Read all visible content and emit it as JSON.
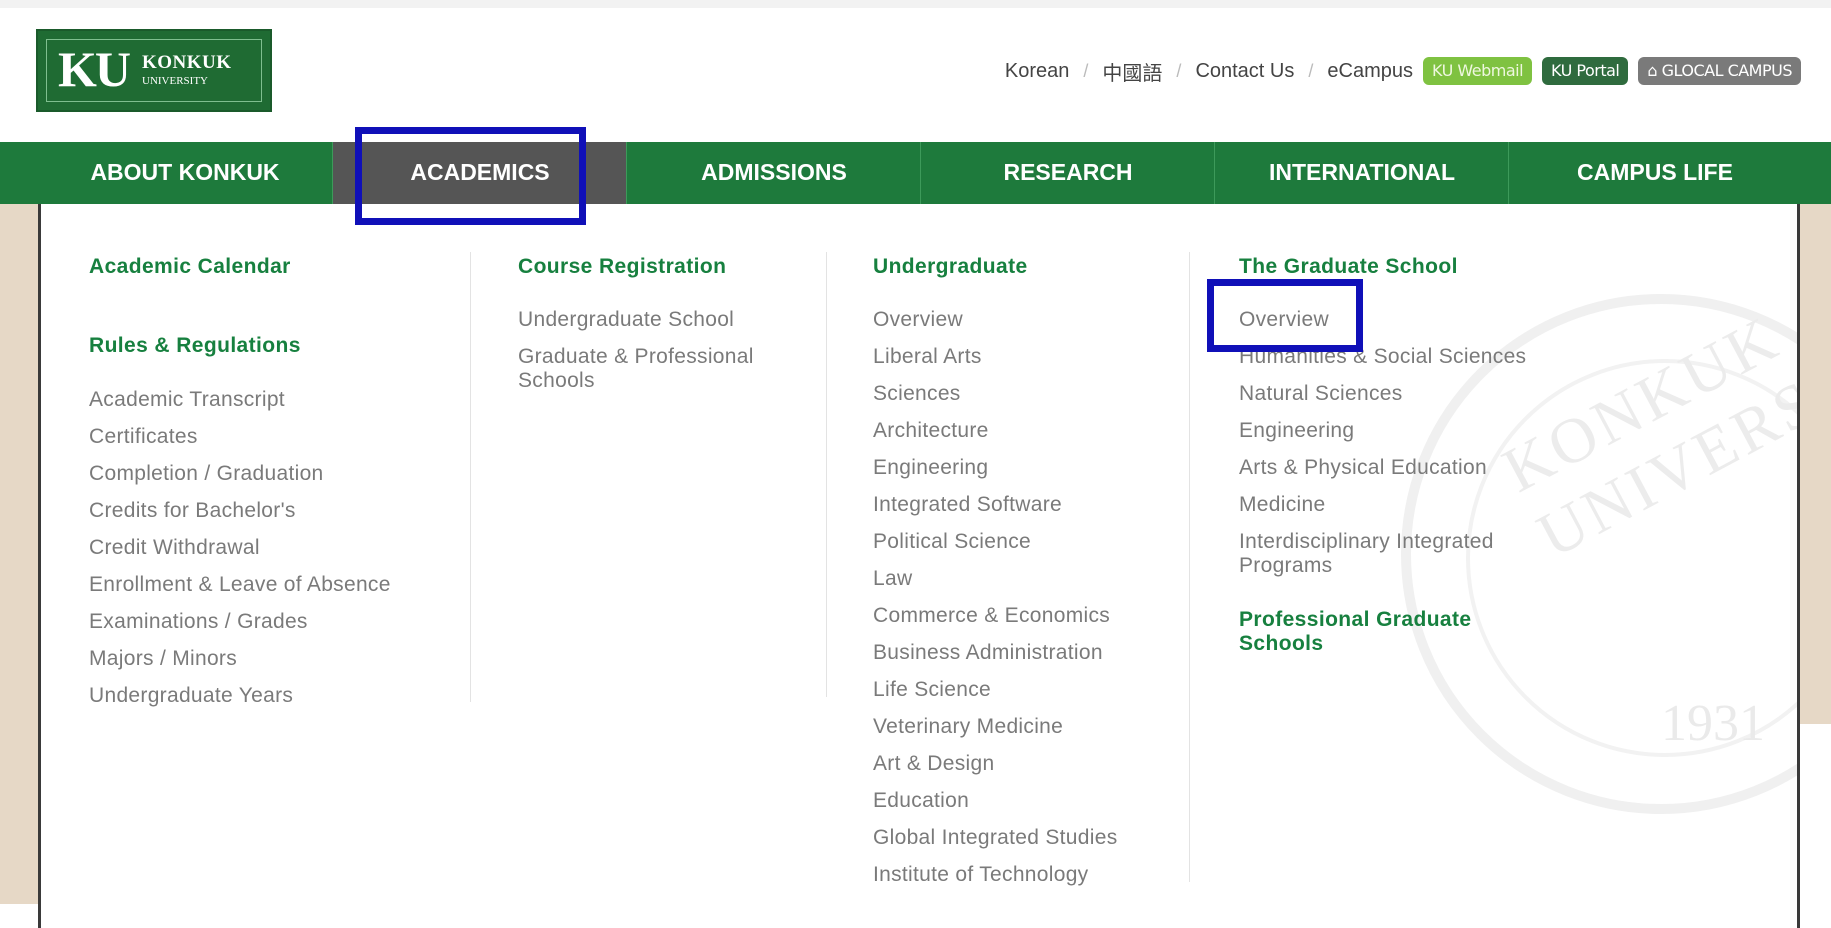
{
  "logo": {
    "mark": "KU",
    "name": "KONKUK",
    "sub": "UNIVERSITY"
  },
  "utility": {
    "links": [
      "Korean",
      "中國語",
      "Contact Us",
      "eCampus"
    ],
    "webmail": "KU Webmail",
    "portal": "KU Portal",
    "glocal": "GLOCAL CAMPUS",
    "glocal_icon": "home-icon"
  },
  "nav": [
    "ABOUT KONKUK",
    "ACADEMICS",
    "ADMISSIONS",
    "RESEARCH",
    "INTERNATIONAL",
    "CAMPUS LIFE"
  ],
  "col1": {
    "heading1": "Academic Calendar",
    "heading2": "Rules & Regulations",
    "links": [
      "Academic Transcript",
      "Certificates",
      "Completion / Graduation",
      "Credits for Bachelor's",
      "Credit Withdrawal",
      "Enrollment & Leave of Absence",
      "Examinations / Grades",
      "Majors / Minors",
      "Undergraduate Years"
    ]
  },
  "col2": {
    "heading": "Course Registration",
    "links": [
      "Undergraduate School",
      "Graduate & Professional Schools"
    ]
  },
  "col3": {
    "heading": "Undergraduate",
    "links": [
      "Overview",
      "Liberal Arts",
      "Sciences",
      "Architecture",
      "Engineering",
      "Integrated Software",
      "Political Science",
      "Law",
      "Commerce & Economics",
      "Business Administration",
      "Life Science",
      "Veterinary Medicine",
      "Art & Design",
      "Education",
      "Global Integrated Studies",
      "Institute of Technology"
    ]
  },
  "col4": {
    "heading": "The Graduate School",
    "links": [
      "Overview",
      "Humanities & Social Sciences",
      "Natural Sciences",
      "Engineering",
      "Arts & Physical Education",
      "Medicine",
      "Interdisciplinary Integrated Programs"
    ],
    "heading2": "Professional Graduate Schools"
  },
  "seal": {
    "text": "KONKUK UNIVERSITY",
    "year": "1931"
  },
  "colors": {
    "brand_green": "#1e7a3c",
    "active_tab": "#555555",
    "heading_green": "#17803f",
    "highlight": "#1010b8"
  }
}
